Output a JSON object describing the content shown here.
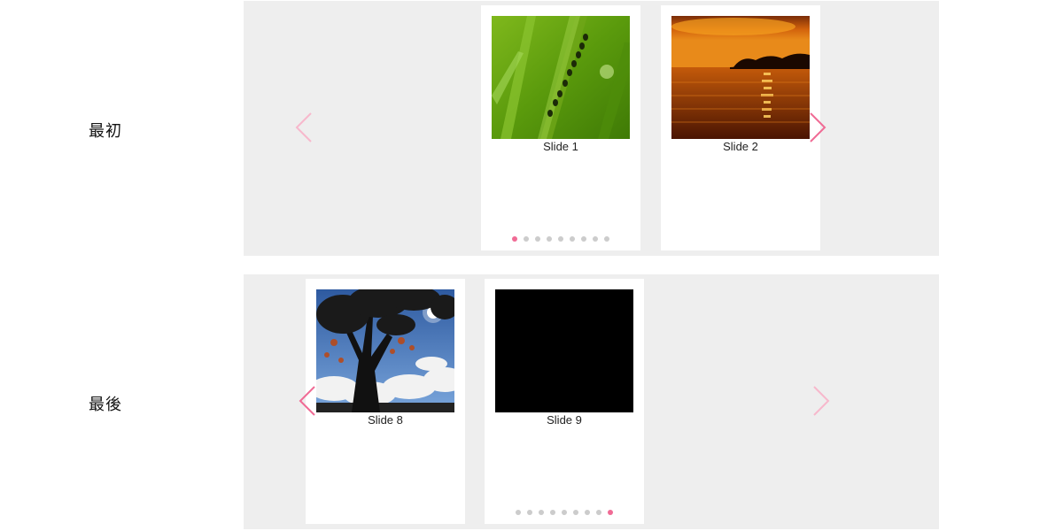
{
  "colors": {
    "accent": "#f06b95",
    "accent_dim": "#f7b8cc",
    "stage_bg": "#eeeeee",
    "dot_inactive": "#cccccc"
  },
  "rows": [
    {
      "label": "最初",
      "slides_visible": [
        {
          "caption": "Slide 1",
          "image": "grass-with-ants"
        },
        {
          "caption": "Slide 2",
          "image": "sunset-over-water"
        }
      ],
      "prev_arrow": {
        "icon": "chevron-left-icon",
        "state": "disabled"
      },
      "next_arrow": {
        "icon": "chevron-right-icon",
        "state": "enabled"
      },
      "pagination": {
        "total": 9,
        "active_index": 0
      }
    },
    {
      "label": "最後",
      "slides_visible": [
        {
          "caption": "Slide 8",
          "image": "tree-silhouette-sky"
        },
        {
          "caption": "Slide 9",
          "image": "black-square"
        }
      ],
      "prev_arrow": {
        "icon": "chevron-left-icon",
        "state": "enabled"
      },
      "next_arrow": {
        "icon": "chevron-right-icon",
        "state": "disabled"
      },
      "pagination": {
        "total": 9,
        "active_index": 8
      }
    }
  ]
}
